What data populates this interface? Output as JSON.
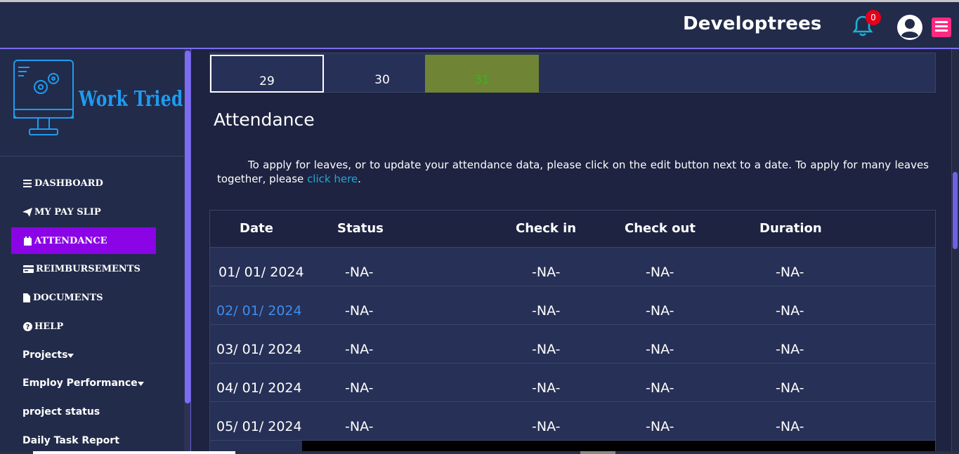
{
  "header": {
    "brand": "Developtrees",
    "notification_count": "0",
    "icons": [
      "bell-icon",
      "user-avatar-icon",
      "hamburger-menu-icon"
    ],
    "colors": {
      "badge": "#e3001b",
      "menu_button": "#ff2a7f",
      "bell": "#19b3d4"
    }
  },
  "sidebar": {
    "logo_text": "Work Tried",
    "items": [
      {
        "label": "DASHBOARD",
        "icon": "bars-icon"
      },
      {
        "label": "MY PAY SLIP",
        "icon": "paper-plane-icon"
      },
      {
        "label": "ATTENDANCE",
        "icon": "calendar-icon",
        "active": true
      },
      {
        "label": "REIMBURSEMENTS",
        "icon": "credit-card-icon"
      },
      {
        "label": "DOCUMENTS",
        "icon": "file-icon"
      },
      {
        "label": "HELP",
        "icon": "question-circle-icon"
      },
      {
        "label": "Projects",
        "icon": "caret-down-icon"
      },
      {
        "label": "Employ Performance",
        "icon": "caret-down-icon"
      },
      {
        "label": "project status"
      },
      {
        "label": "Daily Task Report"
      }
    ],
    "active_color": "#8a04e6"
  },
  "calendar": {
    "days": [
      "29",
      "30",
      "31"
    ],
    "highlight_color": "#6f8435"
  },
  "attendance": {
    "title": "Attendance",
    "description": "To apply for leaves, or to update your attendance data, please click on the edit button next to a date. To apply for many leaves together, please",
    "link_text": "click here",
    "after_link": "."
  },
  "table": {
    "headers": [
      "Date",
      "Status",
      "Check in",
      "Check out",
      "Duration"
    ],
    "rows": [
      [
        "01/ 01/ 2024",
        "-NA-",
        "-NA-",
        "-NA-",
        "-NA-"
      ],
      [
        "02/ 01/ 2024",
        "-NA-",
        "-NA-",
        "-NA-",
        "-NA-"
      ],
      [
        "03/ 01/ 2024",
        "-NA-",
        "-NA-",
        "-NA-",
        "-NA-"
      ],
      [
        "04/ 01/ 2024",
        "-NA-",
        "-NA-",
        "-NA-",
        "-NA-"
      ],
      [
        "05/ 01/ 2024",
        "-NA-",
        "-NA-",
        "-NA-",
        "-NA-"
      ]
    ]
  }
}
